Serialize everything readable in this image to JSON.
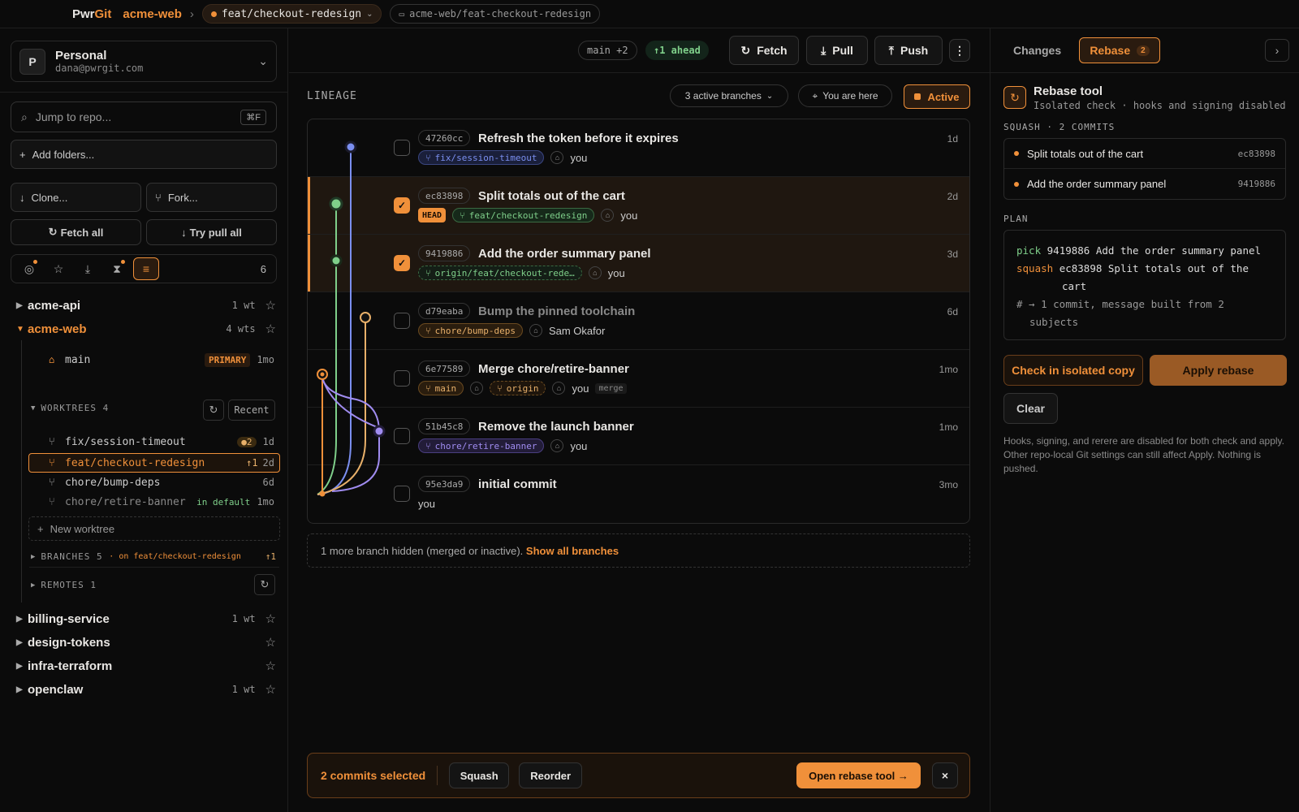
{
  "topbar": {
    "brand_a": "Pwr",
    "brand_b": "Git",
    "repo": "acme-web",
    "sep": "›",
    "branch": "feat/checkout-redesign",
    "path": "acme-web/feat-checkout-redesign"
  },
  "account": {
    "initial": "P",
    "name": "Personal",
    "email": "dana@pwrgit.com"
  },
  "search": {
    "placeholder": "Jump to repo...",
    "shortcut": "⌘F"
  },
  "actions": {
    "add_folders": "Add folders...",
    "clone": "Clone...",
    "fork": "Fork...",
    "fetch_all": "Fetch all",
    "try_pull_all": "Try pull all"
  },
  "iconrow": {
    "count": "6"
  },
  "repos": [
    {
      "name": "acme-api",
      "meta": "1 wt"
    },
    {
      "name": "acme-web",
      "meta": "4 wts"
    },
    {
      "name": "billing-service",
      "meta": "1 wt"
    },
    {
      "name": "design-tokens",
      "meta": ""
    },
    {
      "name": "infra-terraform",
      "meta": ""
    },
    {
      "name": "openclaw",
      "meta": "1 wt"
    }
  ],
  "acmeweb": {
    "main_label": "main",
    "primary_badge": "PRIMARY",
    "main_age": "1mo",
    "worktrees_label": "WORKTREES",
    "worktrees_count": "4",
    "recent": "Recent",
    "worktrees": [
      {
        "name": "fix/session-timeout",
        "badge": "●2",
        "age": "1d"
      },
      {
        "name": "feat/checkout-redesign",
        "badge": "↑1",
        "age": "2d"
      },
      {
        "name": "chore/bump-deps",
        "badge": "",
        "age": "6d"
      },
      {
        "name": "chore/retire-banner",
        "badge": "in default",
        "age": "1mo"
      }
    ],
    "new_worktree": "New worktree",
    "branches_label": "BRANCHES",
    "branches_count": "5",
    "branches_on": "· on feat/checkout-redesign",
    "branches_badge": "↑1",
    "remotes_label": "REMOTES",
    "remotes_count": "1"
  },
  "toolbar": {
    "main_badge": "main +2",
    "ahead": "↑1 ahead",
    "fetch": "Fetch",
    "pull": "Pull",
    "push": "Push"
  },
  "lineage": {
    "title": "LINEAGE",
    "active_branches": "3 active branches",
    "you_are_here": "You are here",
    "active": "Active"
  },
  "commits": [
    {
      "hash": "47260cc",
      "msg": "Refresh the token before it expires",
      "tags": [
        {
          "t": "fix/session-timeout",
          "c": "blue"
        }
      ],
      "author": "you",
      "age": "1d",
      "sel": false,
      "dim": false
    },
    {
      "hash": "ec83898",
      "msg": "Split totals out of the cart",
      "tags": [
        {
          "t": "HEAD",
          "c": "head"
        },
        {
          "t": "feat/checkout-redesign",
          "c": "green"
        }
      ],
      "author": "you",
      "age": "2d",
      "sel": true,
      "dim": false
    },
    {
      "hash": "9419886",
      "msg": "Add the order summary panel",
      "tags": [
        {
          "t": "origin/feat/checkout-rede…",
          "c": "green-dash"
        }
      ],
      "author": "you",
      "age": "3d",
      "sel": true,
      "dim": false
    },
    {
      "hash": "d79eaba",
      "msg": "Bump the pinned toolchain",
      "tags": [
        {
          "t": "chore/bump-deps",
          "c": "orange"
        }
      ],
      "author": "Sam Okafor",
      "age": "6d",
      "sel": false,
      "dim": true
    },
    {
      "hash": "6e77589",
      "msg": "Merge chore/retire-banner",
      "tags": [
        {
          "t": "main",
          "c": "orange"
        },
        {
          "t": "origin",
          "c": "orange-dash"
        }
      ],
      "author": "you",
      "extra": "merge",
      "age": "1mo",
      "sel": false,
      "dim": false
    },
    {
      "hash": "51b45c8",
      "msg": "Remove the launch banner",
      "tags": [
        {
          "t": "chore/retire-banner",
          "c": "purple"
        }
      ],
      "author": "you",
      "age": "1mo",
      "sel": false,
      "dim": false
    },
    {
      "hash": "95e3da9",
      "msg": "initial commit",
      "tags": [],
      "author": "you",
      "age": "3mo",
      "sel": false,
      "dim": false
    }
  ],
  "hidden": {
    "text": "1 more branch hidden (merged or inactive).",
    "link": "Show all branches"
  },
  "selection": {
    "text": "2 commits selected",
    "squash": "Squash",
    "reorder": "Reorder",
    "open": "Open rebase tool →",
    "close": "×"
  },
  "right": {
    "tab_changes": "Changes",
    "tab_rebase": "Rebase",
    "tab_rebase_count": "2",
    "tool_title": "Rebase tool",
    "tool_sub": "Isolated check · hooks and signing disabled",
    "squash_label": "SQUASH · 2 COMMITS",
    "squash_items": [
      {
        "msg": "Split totals out of the cart",
        "hash": "ec83898"
      },
      {
        "msg": "Add the order summary panel",
        "hash": "9419886"
      }
    ],
    "plan_label": "PLAN",
    "plan_pick": "pick",
    "plan_pick_rest": "9419886 Add the order summary panel",
    "plan_squash": "squash",
    "plan_squash_rest": "ec83898 Split totals out of the",
    "plan_squash_cont": "cart",
    "plan_comment": "# → 1 commit, message built from 2",
    "plan_comment_cont": "subjects",
    "check_btn": "Check in isolated copy",
    "apply_btn": "Apply rebase",
    "clear_btn": "Clear",
    "note": "Hooks, signing, and rerere are disabled for both check and apply. Other repo-local Git settings can still affect Apply. Nothing is pushed."
  },
  "colors": {
    "accent": "#f0903a",
    "blue": "#7b8ff0",
    "green": "#7fcf8a",
    "orange": "#e8b06a",
    "purple": "#a08cf0"
  }
}
